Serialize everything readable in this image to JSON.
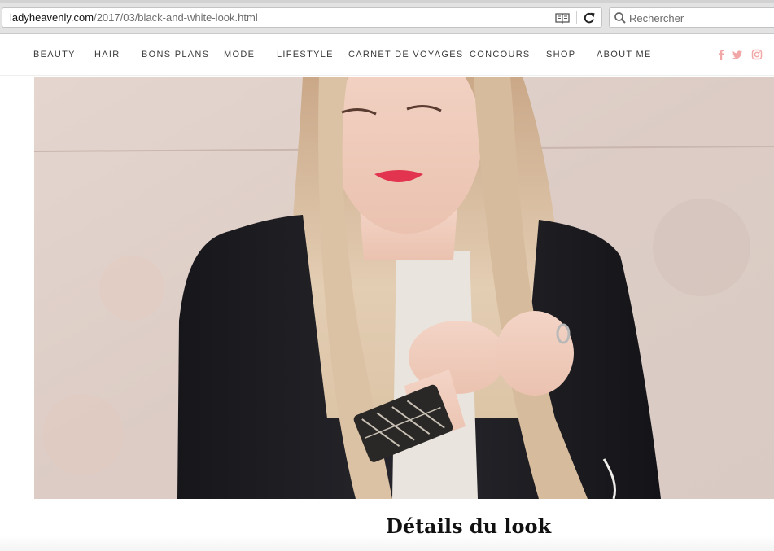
{
  "browser": {
    "url_host": "ladyheavenly.com",
    "url_path": "/2017/03/black-and-white-look.html",
    "search_placeholder": "Rechercher",
    "icons": [
      "reader-view-icon",
      "reload-icon",
      "search-icon"
    ]
  },
  "nav": {
    "items": [
      {
        "label": "BEAUTY"
      },
      {
        "label": "HAIR"
      },
      {
        "label": "BONS PLANS"
      },
      {
        "label": "MODE"
      },
      {
        "label": "LIFESTYLE"
      },
      {
        "label": "CARNET DE VOYAGES"
      },
      {
        "label": "CONCOURS"
      },
      {
        "label": "SHOP"
      },
      {
        "label": "ABOUT ME"
      }
    ],
    "social_icons": [
      "facebook-icon",
      "twitter-icon",
      "instagram-icon"
    ],
    "social_color": "#f2a7a7"
  },
  "post": {
    "section_title": "Détails du look"
  }
}
